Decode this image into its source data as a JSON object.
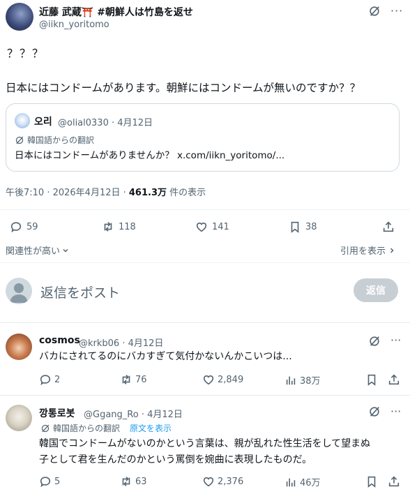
{
  "main_post": {
    "display_name": "近藤 武蔵⛩️ #朝鮮人は竹島を返せ",
    "handle": "@iikn_yoritomo",
    "text_line1": "？？？",
    "text_line2": "日本にはコンドームがあります。朝鮮にはコンドームが無いのですか？？",
    "timestamp": "午後7:10 · 2026年4月12日 · ",
    "views_count": "461.3万",
    "views_label": " 件の表示",
    "replies": "59",
    "reposts": "118",
    "likes": "141",
    "bookmarks": "38"
  },
  "quote": {
    "display_name": "오리",
    "handle_date": "@olial0330 · 4月12日",
    "translation_label": "韓国語からの翻訳",
    "text": "日本にはコンドームがありませんか？ x.com/iikn_yoritomo/..."
  },
  "controls": {
    "sort_label": "関連性が高い",
    "quotes_label": "引用を表示",
    "reply_placeholder": "返信をポスト",
    "reply_button": "返信"
  },
  "replies": [
    {
      "display_name": "cosmos",
      "handle_date": "@krkb06 · 4月12日",
      "text": "バカにされてるのにバカすぎて気付かないんかこいつは...",
      "replies": "2",
      "reposts": "76",
      "likes": "2,849",
      "views": "38万"
    },
    {
      "display_name": "깡통로봇",
      "handle_date": "@Ggang_Ro · 4月12日",
      "translation_label": "韓国語からの翻訳",
      "show_original": "原文を表示",
      "text_line1": "韓国でコンドームがないのかという言葉は、親が乱れた性生活をして望まぬ",
      "text_line2": "子として君を生んだのかという罵倒を婉曲に表現したものだ。",
      "replies": "5",
      "reposts": "63",
      "likes": "2,376",
      "views": "46万"
    }
  ],
  "colors": {
    "accent": "#1d9bf0",
    "text": "#0f1419",
    "muted": "#536471",
    "button_disabled": "#e0e0e0"
  }
}
